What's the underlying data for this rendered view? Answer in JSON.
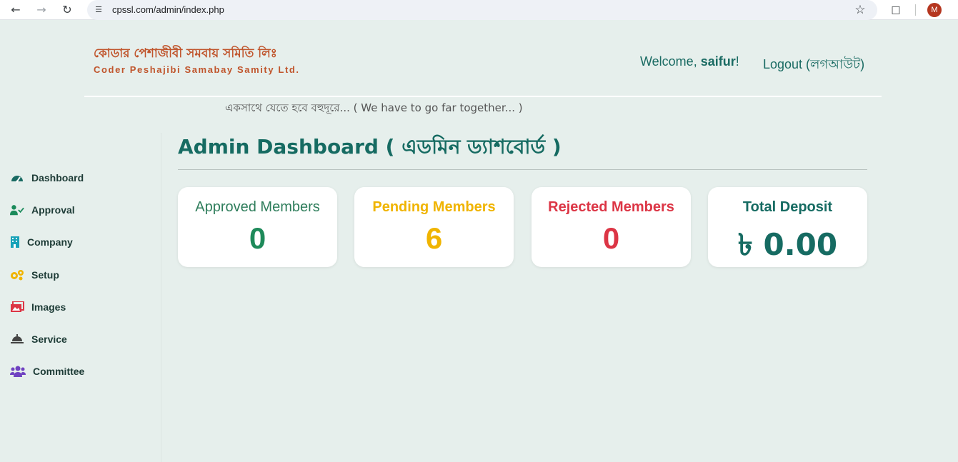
{
  "browser": {
    "url": "cpssl.com/admin/index.php",
    "profile_initial": "M"
  },
  "header": {
    "brand_bn": "কোডার পেশাজীবী সমবায় সমিতি লিঃ",
    "brand_en": "Coder Peshajibi Samabay Samity Ltd.",
    "welcome_prefix": "Welcome, ",
    "username": "saifur",
    "welcome_suffix": "!",
    "logout_label": "Logout (লগআউট)",
    "tagline": "একসাথে যেতে হবে বহুদূরে... ( We have to go far together... )"
  },
  "sidebar": {
    "items": [
      {
        "label": "Dashboard",
        "icon": "gauge-icon",
        "color": "#1a6b63"
      },
      {
        "label": "Approval",
        "icon": "user-check-icon",
        "color": "#1a8a5a"
      },
      {
        "label": "Company",
        "icon": "building-icon",
        "color": "#17a2b8"
      },
      {
        "label": "Setup",
        "icon": "gears-icon",
        "color": "#f0b400"
      },
      {
        "label": "Images",
        "icon": "images-icon",
        "color": "#dc3545"
      },
      {
        "label": "Service",
        "icon": "bell-concierge-icon",
        "color": "#444444"
      },
      {
        "label": "Committee",
        "icon": "users-icon",
        "color": "#6f42c1"
      }
    ]
  },
  "main": {
    "title": "Admin Dashboard ( এডমিন ড্যাশবোর্ড )",
    "cards": [
      {
        "title": "Approved Members",
        "value": "0",
        "color": "#1e8a5a",
        "title_color": "#2e7d5b"
      },
      {
        "title": "Pending Members",
        "value": "6",
        "color": "#f0b400",
        "title_color": "#f0b400"
      },
      {
        "title": "Rejected Members",
        "value": "0",
        "color": "#dc3545",
        "title_color": "#dc3545"
      },
      {
        "title": "Total Deposit",
        "value": "৳ 0.00",
        "color": "#166b62",
        "title_color": "#166b62"
      }
    ]
  }
}
